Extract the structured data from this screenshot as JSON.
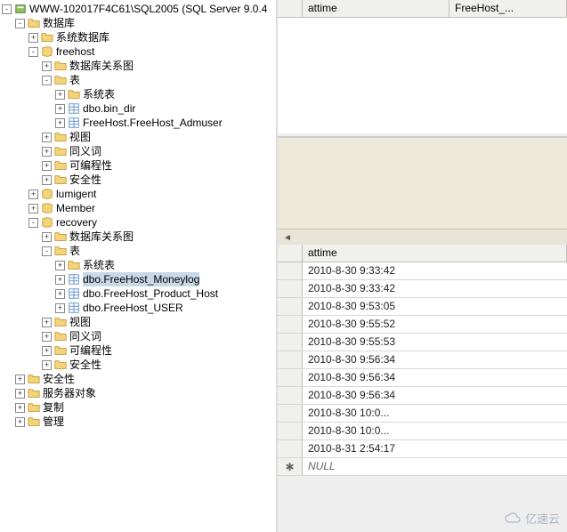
{
  "server": {
    "name": "WWW-102017F4C61\\SQL2005 (SQL Server 9.0.4"
  },
  "tree": {
    "databases": "数据库",
    "sysdb": "系统数据库",
    "freehost": "freehost",
    "dbdiagram": "数据库关系图",
    "tables": "表",
    "systables": "系统表",
    "fh_bin": "dbo.bin_dir",
    "fh_admuser": "FreeHost.FreeHost_Admuser",
    "views": "视图",
    "synonyms": "同义词",
    "programmability": "可编程性",
    "security": "安全性",
    "lumigent": "lumigent",
    "member": "Member",
    "recovery": "recovery",
    "rc_moneylog": "dbo.FreeHost_Moneylog",
    "rc_producthost": "dbo.FreeHost_Product_Host",
    "rc_user": "dbo.FreeHost_USER",
    "security_top": "安全性",
    "server_objects": "服务器对象",
    "replication": "复制",
    "management": "管理"
  },
  "top_grid": {
    "cols": [
      "attime",
      "FreeHost_..."
    ]
  },
  "bottom_grid": {
    "col": "attime",
    "rows": [
      "2010-8-30 9:33:42",
      "2010-8-30 9:33:42",
      "2010-8-30 9:53:05",
      "2010-8-30 9:55:52",
      "2010-8-30 9:55:53",
      "2010-8-30 9:56:34",
      "2010-8-30 9:56:34",
      "2010-8-30 9:56:34",
      "2010-8-30 10:0...",
      "2010-8-30 10:0...",
      "2010-8-31 2:54:17"
    ],
    "null_label": "NULL"
  },
  "watermark": "亿速云"
}
